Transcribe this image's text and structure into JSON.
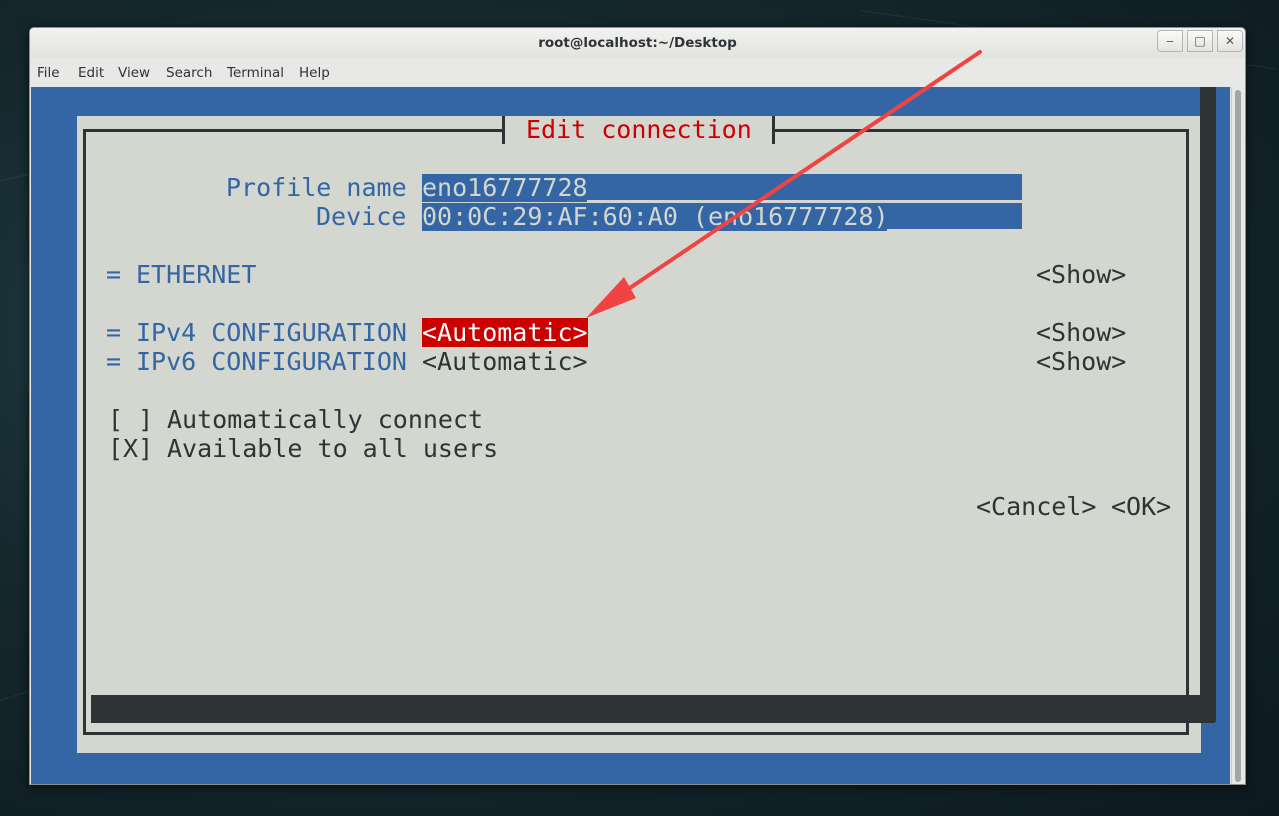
{
  "window": {
    "title": "root@localhost:~/Desktop",
    "controls": {
      "minimize": "‒",
      "maximize": "□",
      "close": "✕"
    }
  },
  "menubar": [
    "File",
    "Edit",
    "View",
    "Search",
    "Terminal",
    "Help"
  ],
  "dialog": {
    "title": "Edit connection",
    "profile_label": "Profile name",
    "profile_value": "eno16777728",
    "device_label": "Device",
    "device_value": "00:0C:29:AF:60:A0 (eno16777728)",
    "ethernet": {
      "marker": "=",
      "label": "ETHERNET",
      "show": "<Show>"
    },
    "ipv4": {
      "marker": "=",
      "label": "IPv4 CONFIGURATION",
      "mode": "<Automatic>",
      "show": "<Show>"
    },
    "ipv6": {
      "marker": "=",
      "label": "IPv6 CONFIGURATION",
      "mode": "<Automatic>",
      "show": "<Show>"
    },
    "auto_connect": {
      "box": "[ ]",
      "label": "Automatically connect",
      "checked": false
    },
    "all_users": {
      "box": "[X]",
      "label": "Available to all users",
      "checked": true
    },
    "cancel": "<Cancel>",
    "ok": "<OK>"
  },
  "colors": {
    "terminal_bg": "#3465a4",
    "dialog_bg": "#d3d7cf",
    "accent_red": "#cc0000",
    "annotation_arrow": "#f04444"
  }
}
